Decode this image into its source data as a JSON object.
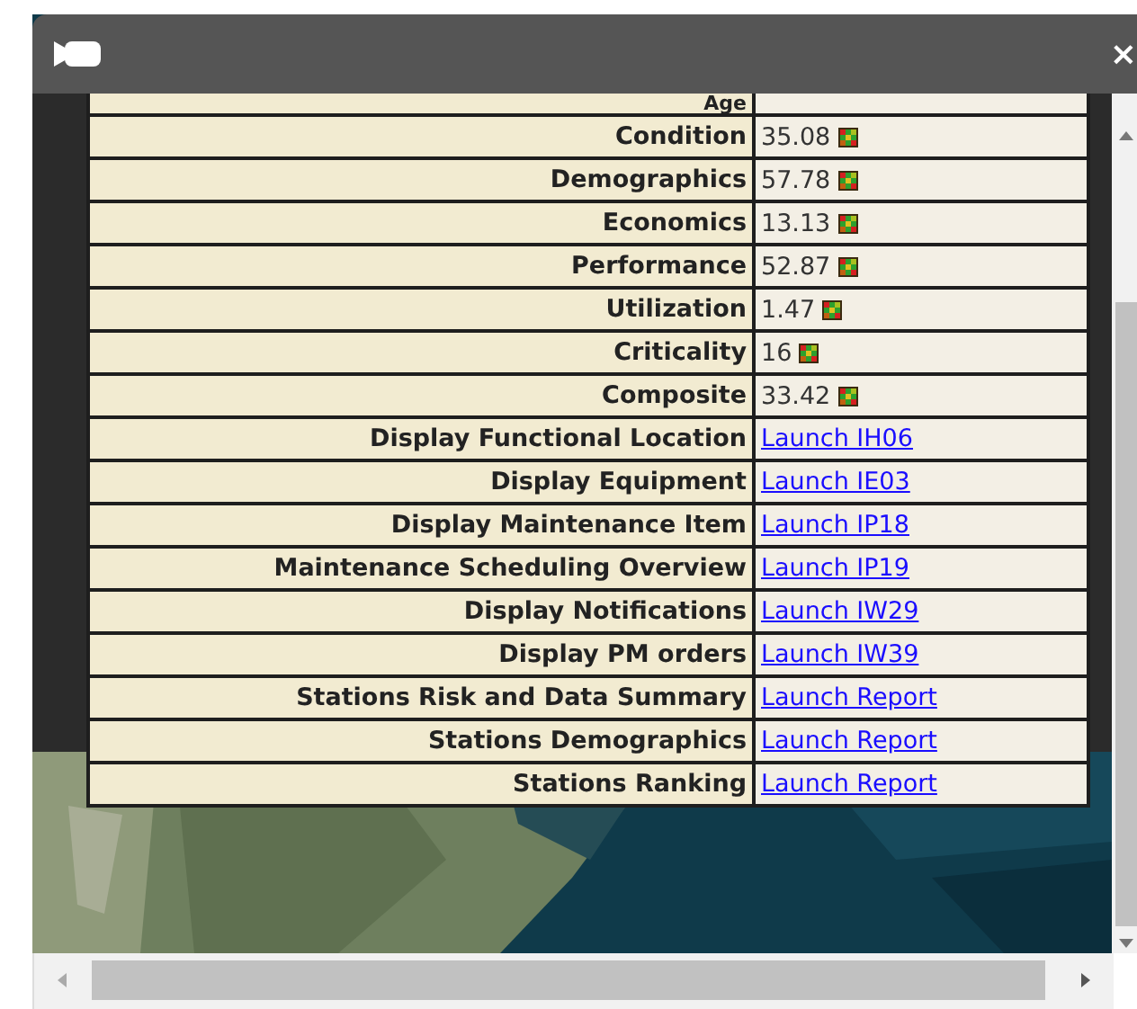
{
  "window": {
    "close": "×"
  },
  "rows": [
    {
      "label": "Age",
      "kind": "clipped"
    },
    {
      "label": "Condition",
      "kind": "score",
      "value": "35.08"
    },
    {
      "label": "Demographics",
      "kind": "score",
      "value": "57.78"
    },
    {
      "label": "Economics",
      "kind": "score",
      "value": "13.13"
    },
    {
      "label": "Performance",
      "kind": "score",
      "value": "52.87"
    },
    {
      "label": "Utilization",
      "kind": "score",
      "value": "1.47"
    },
    {
      "label": "Criticality",
      "kind": "score",
      "value": "16"
    },
    {
      "label": "Composite",
      "kind": "score",
      "value": "33.42"
    },
    {
      "label": "Display Functional Location",
      "kind": "link",
      "value": "Launch IH06"
    },
    {
      "label": "Display Equipment",
      "kind": "link",
      "value": "Launch IE03"
    },
    {
      "label": "Display Maintenance Item",
      "kind": "link",
      "value": "Launch IP18"
    },
    {
      "label": "Maintenance Scheduling Overview",
      "kind": "link",
      "value": "Launch IP19"
    },
    {
      "label": "Display Notifications",
      "kind": "link",
      "value": "Launch IW29"
    },
    {
      "label": "Display PM orders",
      "kind": "link",
      "value": "Launch IW39"
    },
    {
      "label": "Stations Risk and Data Summary",
      "kind": "link",
      "value": "Launch Report"
    },
    {
      "label": "Stations Demographics",
      "kind": "link",
      "value": "Launch Report"
    },
    {
      "label": "Stations Ranking",
      "kind": "link",
      "value": "Launch Report"
    }
  ]
}
